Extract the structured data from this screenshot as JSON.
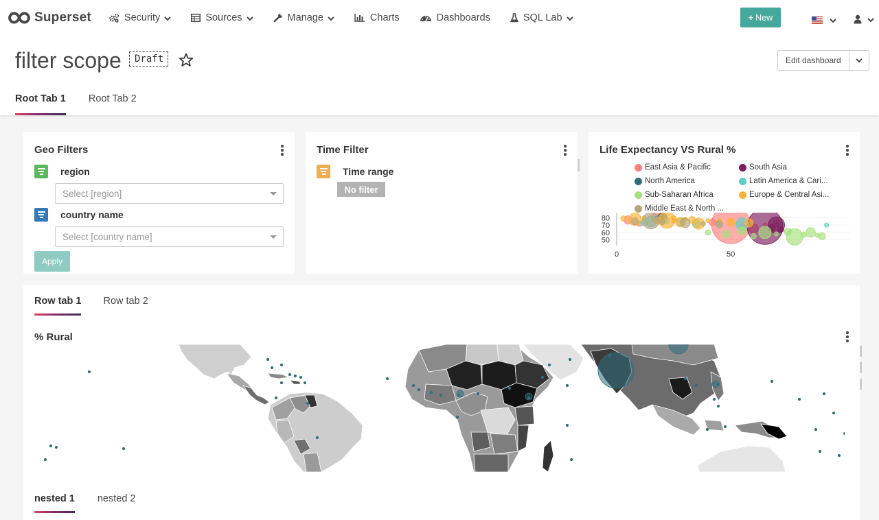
{
  "navbar": {
    "brand": "Superset",
    "items": [
      {
        "label": "Security",
        "icon": "cogs-icon",
        "dropdown": true
      },
      {
        "label": "Sources",
        "icon": "table-icon",
        "dropdown": true
      },
      {
        "label": "Manage",
        "icon": "wrench-icon",
        "dropdown": true
      },
      {
        "label": "Charts",
        "icon": "bar-chart-icon",
        "dropdown": false
      },
      {
        "label": "Dashboards",
        "icon": "dashboard-icon",
        "dropdown": false
      },
      {
        "label": "SQL Lab",
        "icon": "flask-icon",
        "dropdown": true
      }
    ],
    "new_button": "New",
    "accent": "#45a89c"
  },
  "header": {
    "title": "filter scope",
    "draft_badge": "Draft",
    "edit_button": "Edit dashboard",
    "tabs": [
      {
        "label": "Root Tab 1",
        "active": true
      },
      {
        "label": "Root Tab 2",
        "active": false
      }
    ]
  },
  "geo_filters": {
    "title": "Geo Filters",
    "filters": [
      {
        "label": "region",
        "placeholder": "Select [region]",
        "color": "#5cb85c"
      },
      {
        "label": "country name",
        "placeholder": "Select [country name]",
        "color": "#337ab7"
      }
    ],
    "apply_label": "Apply"
  },
  "time_filter": {
    "title": "Time Filter",
    "label": "Time range",
    "value": "No filter",
    "color": "#f0ad4e"
  },
  "bubble_chart": {
    "title": "Life Expectancy VS Rural %",
    "legend": [
      {
        "name": "East Asia & Pacific",
        "color": "#ff7f7f"
      },
      {
        "name": "South Asia",
        "color": "#7c1d5c"
      },
      {
        "name": "North America",
        "color": "#2f6f7e"
      },
      {
        "name": "Latin America & Cari...",
        "color": "#5ad1c6"
      },
      {
        "name": "Sub-Saharan Africa",
        "color": "#a5e07a"
      },
      {
        "name": "Europe & Central Asi...",
        "color": "#ffb232"
      },
      {
        "name": "Middle East & North ...",
        "color": "#b5a57e"
      }
    ]
  },
  "chart_data": {
    "type": "scatter",
    "title": "Life Expectancy VS Rural %",
    "xlabel": "",
    "ylabel": "",
    "x_ticks": [
      "0",
      "50"
    ],
    "y_ticks": [
      "80",
      "70",
      "60",
      "50"
    ],
    "xlim": [
      0,
      100
    ],
    "ylim": [
      45,
      85
    ],
    "series": [
      {
        "name": "East Asia & Pacific",
        "color": "#ff7f7f",
        "points": [
          [
            5,
            77
          ],
          [
            10,
            72
          ],
          [
            18,
            80
          ],
          [
            25,
            76
          ],
          [
            42,
            74
          ],
          [
            50,
            71
          ],
          [
            55,
            68
          ],
          [
            60,
            65
          ],
          [
            65,
            70
          ],
          [
            70,
            72
          ]
        ]
      },
      {
        "name": "South Asia",
        "color": "#7c1d5c",
        "points": [
          [
            65,
            68
          ],
          [
            68,
            66
          ],
          [
            70,
            70
          ],
          [
            72,
            64
          ]
        ]
      },
      {
        "name": "North America",
        "color": "#2f6f7e",
        "points": [
          [
            18,
            79
          ],
          [
            20,
            80
          ]
        ]
      },
      {
        "name": "Latin America & Cari...",
        "color": "#5ad1c6",
        "points": [
          [
            12,
            74
          ],
          [
            15,
            75
          ],
          [
            20,
            73
          ],
          [
            22,
            76
          ],
          [
            28,
            74
          ],
          [
            35,
            72
          ],
          [
            45,
            73
          ],
          [
            55,
            71
          ],
          [
            92,
            70
          ]
        ]
      },
      {
        "name": "Sub-Saharan Africa",
        "color": "#a5e07a",
        "points": [
          [
            40,
            60
          ],
          [
            48,
            58
          ],
          [
            55,
            62
          ],
          [
            60,
            55
          ],
          [
            65,
            60
          ],
          [
            70,
            58
          ],
          [
            75,
            61
          ],
          [
            78,
            54
          ],
          [
            82,
            57
          ],
          [
            85,
            60
          ],
          [
            88,
            56
          ],
          [
            90,
            55
          ]
        ]
      },
      {
        "name": "Europe & Central Asi...",
        "color": "#ffb232",
        "points": [
          [
            3,
            79
          ],
          [
            8,
            78
          ],
          [
            12,
            80
          ],
          [
            18,
            76
          ],
          [
            22,
            77
          ],
          [
            25,
            79
          ],
          [
            28,
            74
          ],
          [
            30,
            78
          ],
          [
            33,
            77
          ],
          [
            36,
            72
          ],
          [
            40,
            76
          ],
          [
            45,
            75
          ],
          [
            50,
            74
          ],
          [
            58,
            73
          ]
        ]
      },
      {
        "name": "Middle East & North ...",
        "color": "#b5a57e",
        "points": [
          [
            8,
            75
          ],
          [
            15,
            76
          ],
          [
            20,
            74
          ],
          [
            30,
            73
          ],
          [
            38,
            72
          ],
          [
            45,
            71
          ]
        ]
      }
    ]
  },
  "row_tabs": [
    {
      "label": "Row tab 1",
      "active": true
    },
    {
      "label": "Row tab 2",
      "active": false
    }
  ],
  "map_chart": {
    "title": "% Rural"
  },
  "nested_tabs": [
    {
      "label": "nested 1",
      "active": true
    },
    {
      "label": "nested 2",
      "active": false
    }
  ]
}
